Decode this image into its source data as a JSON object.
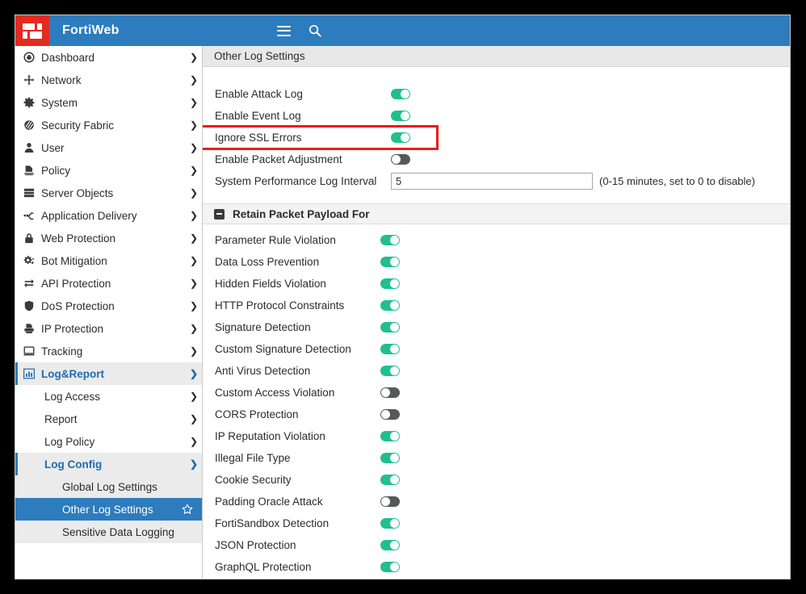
{
  "app": {
    "brand": "FortiWeb",
    "logo_icon": "fortinet-logo-icon",
    "menu_icon": "hamburger-menu-icon",
    "search_icon": "search-icon",
    "accent_blue": "#2c7cbe",
    "brand_red": "#e32b20",
    "toggle_on_color": "#20bf8e",
    "toggle_off_color": "#55595b",
    "annotation_color": "#ee1b18"
  },
  "sidebar": {
    "items": [
      {
        "label": "Dashboard",
        "icon": "gauge-icon",
        "chevron": "chevron-right-icon"
      },
      {
        "label": "Network",
        "icon": "move-arrows-icon",
        "chevron": "chevron-right-icon"
      },
      {
        "label": "System",
        "icon": "gear-icon",
        "chevron": "chevron-right-icon"
      },
      {
        "label": "Security Fabric",
        "icon": "striped-circle-icon",
        "chevron": "chevron-right-icon"
      },
      {
        "label": "User",
        "icon": "person-icon",
        "chevron": "chevron-right-icon"
      },
      {
        "label": "Policy",
        "icon": "document-stamp-icon",
        "chevron": "chevron-right-icon"
      },
      {
        "label": "Server Objects",
        "icon": "server-stack-icon",
        "chevron": "chevron-right-icon"
      },
      {
        "label": "Application Delivery",
        "icon": "branch-icon",
        "chevron": "chevron-right-icon"
      },
      {
        "label": "Web Protection",
        "icon": "lock-icon",
        "chevron": "chevron-right-icon"
      },
      {
        "label": "Bot Mitigation",
        "icon": "gears-icon",
        "chevron": "chevron-right-icon"
      },
      {
        "label": "API Protection",
        "icon": "exchange-arrows-icon",
        "chevron": "chevron-right-icon"
      },
      {
        "label": "DoS Protection",
        "icon": "shield-icon",
        "chevron": "chevron-right-icon"
      },
      {
        "label": "IP Protection",
        "icon": "printer-icon",
        "chevron": "chevron-right-icon"
      },
      {
        "label": "Tracking",
        "icon": "monitor-icon",
        "chevron": "chevron-right-icon"
      }
    ],
    "log_report": {
      "label": "Log&Report",
      "icon": "bar-chart-icon",
      "chevron": "chevron-down-icon",
      "children": [
        {
          "label": "Log Access",
          "chevron": "chevron-right-icon"
        },
        {
          "label": "Report",
          "chevron": "chevron-right-icon"
        },
        {
          "label": "Log Policy",
          "chevron": "chevron-right-icon"
        }
      ],
      "log_config": {
        "label": "Log Config",
        "chevron": "chevron-down-icon",
        "leaves": [
          {
            "label": "Global Log Settings",
            "selected": false,
            "star": false
          },
          {
            "label": "Other Log Settings",
            "selected": true,
            "star": true,
            "star_icon": "star-outline-icon"
          },
          {
            "label": "Sensitive Data Logging",
            "selected": false,
            "star": false
          }
        ]
      }
    }
  },
  "main": {
    "panel_title": "Other Log Settings",
    "top_settings": [
      {
        "label": "Enable Attack Log",
        "state": "on"
      },
      {
        "label": "Enable Event Log",
        "state": "on"
      },
      {
        "label": "Ignore SSL Errors",
        "state": "on",
        "highlighted": true
      },
      {
        "label": "Enable Packet Adjustment",
        "state": "off"
      }
    ],
    "interval_setting": {
      "label": "System Performance Log Interval",
      "value": "5",
      "hint": "(0-15 minutes, set to 0 to disable)"
    },
    "retain_section": {
      "title": "Retain Packet Payload For",
      "collapse_icon": "minus-box-icon",
      "rows": [
        {
          "label": "Parameter Rule Violation",
          "state": "on"
        },
        {
          "label": "Data Loss Prevention",
          "state": "on"
        },
        {
          "label": "Hidden Fields Violation",
          "state": "on"
        },
        {
          "label": "HTTP Protocol Constraints",
          "state": "on"
        },
        {
          "label": "Signature Detection",
          "state": "on"
        },
        {
          "label": "Custom Signature Detection",
          "state": "on"
        },
        {
          "label": "Anti Virus Detection",
          "state": "on"
        },
        {
          "label": "Custom Access Violation",
          "state": "off"
        },
        {
          "label": "CORS Protection",
          "state": "off"
        },
        {
          "label": "IP Reputation Violation",
          "state": "on"
        },
        {
          "label": "Illegal File Type",
          "state": "on"
        },
        {
          "label": "Cookie Security",
          "state": "on"
        },
        {
          "label": "Padding Oracle Attack",
          "state": "off"
        },
        {
          "label": "FortiSandbox Detection",
          "state": "on"
        },
        {
          "label": "JSON Protection",
          "state": "on"
        },
        {
          "label": "GraphQL Protection",
          "state": "on"
        }
      ]
    }
  }
}
